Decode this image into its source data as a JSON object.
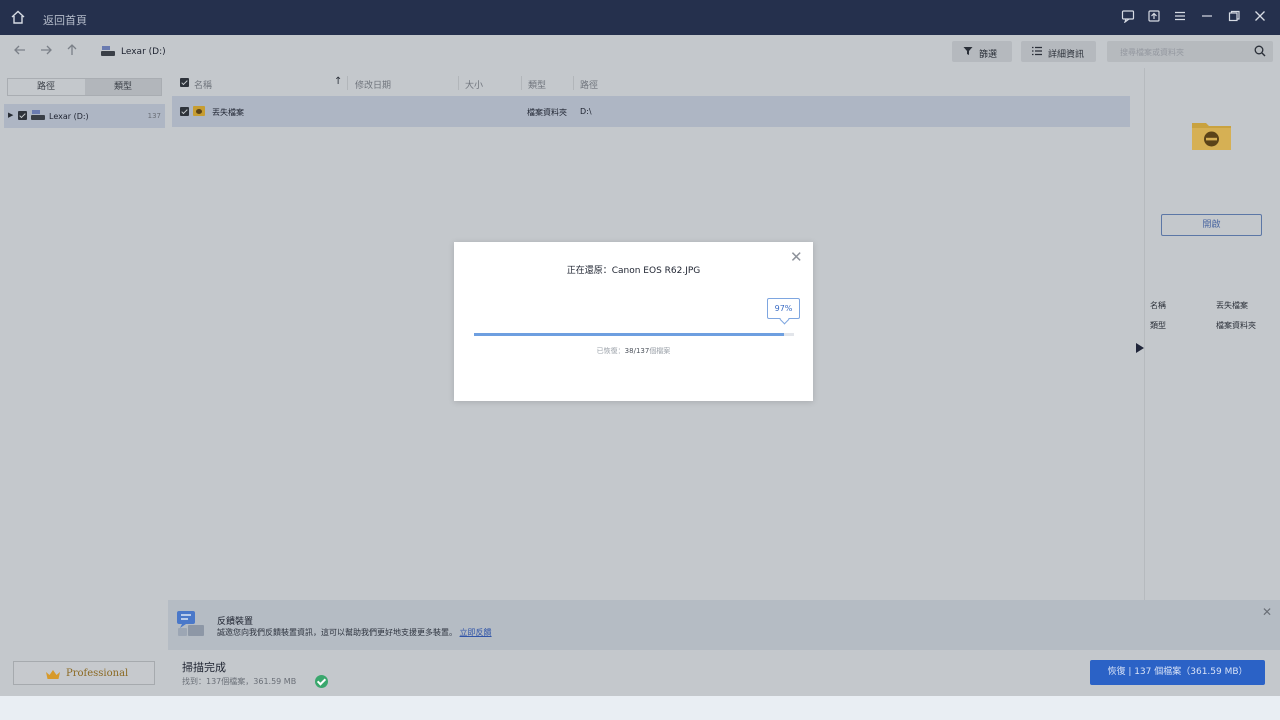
{
  "titlebar": {
    "back_home_label": "返回首頁",
    "icons": [
      "home-icon",
      "feedback-icon",
      "upload-icon",
      "menu-icon",
      "minimize-icon",
      "restore-icon",
      "close-icon"
    ]
  },
  "navbar": {
    "breadcrumb": "Lexar (D:)",
    "filter_label": "篩選",
    "details_label": "詳細資訊",
    "search_placeholder": "搜尋檔案或資料夾"
  },
  "left_panel": {
    "tab_path": "路徑",
    "tab_type": "類型",
    "tree_item_label": "Lexar (D:)",
    "tree_item_count": "137",
    "pro_label": "Professional"
  },
  "table": {
    "headers": {
      "name": "名稱",
      "modified": "修改日期",
      "size": "大小",
      "type": "類型",
      "path": "路徑"
    },
    "rows": [
      {
        "name": "丟失檔案",
        "modified": "",
        "size": "",
        "type": "檔案資料夾",
        "path": "D:\\"
      }
    ]
  },
  "right_panel": {
    "open_label": "開啟",
    "name_key": "名稱",
    "name_value": "丟失檔案",
    "type_key": "類型",
    "type_value": "檔案資料夾"
  },
  "feedback": {
    "title": "反饋裝置",
    "description": "誠邀您向我們反饋裝置資訊，這可以幫助我們更好地支援更多裝置。",
    "link": "立即反饋"
  },
  "status": {
    "title": "掃描完成",
    "found": "找到：137個檔案，361.59 MB",
    "recover_label": "恢復 | 137 個檔案（361.59 MB）"
  },
  "dialog": {
    "heading_prefix": "正在還原：",
    "filename": "Canon EOS R62.JPG",
    "percent_label": "97%",
    "progress": 0.97,
    "restored_prefix": "已恢復：",
    "restored_count": "38/137",
    "restored_suffix": "個檔案"
  },
  "colors": {
    "titlebar": "#25304d",
    "accent": "#2b62c6",
    "progress": "#6e9fe0",
    "success": "#3aa76d"
  }
}
